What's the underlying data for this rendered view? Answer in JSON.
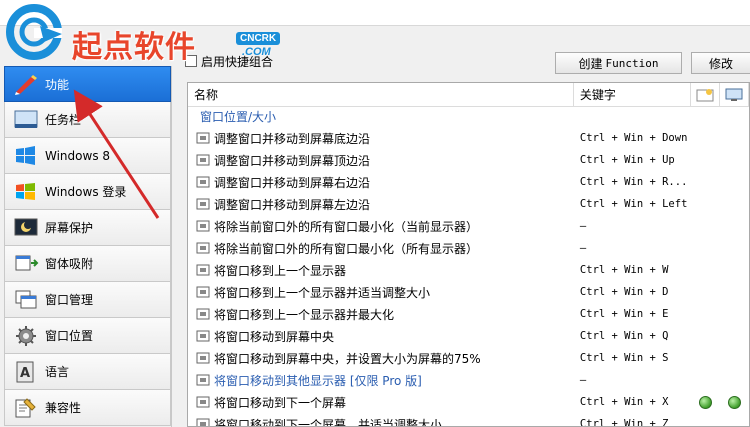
{
  "logo": {
    "text": "起点软件",
    "badge": "CNCRK",
    "domain": ".COM"
  },
  "options": {
    "checkbox_label": "启用快捷组合"
  },
  "toolbar": {
    "create_prefix": "创建",
    "create_keyword": "Function",
    "edit_label": "修改"
  },
  "sidebar": {
    "items": [
      {
        "label": "功能",
        "icon": "pen-icon",
        "active": true
      },
      {
        "label": "任务栏",
        "icon": "taskbar-icon"
      },
      {
        "label": "Windows 8",
        "icon": "windows8-icon"
      },
      {
        "label": "Windows 登录",
        "icon": "windows-logo-icon"
      },
      {
        "label": "屏幕保护",
        "icon": "screensaver-icon"
      },
      {
        "label": "窗体吸附",
        "icon": "window-snap-icon"
      },
      {
        "label": "窗口管理",
        "icon": "window-manage-icon"
      },
      {
        "label": "窗口位置",
        "icon": "gear-icon"
      },
      {
        "label": "语言",
        "icon": "language-icon"
      },
      {
        "label": "兼容性",
        "icon": "compatibility-icon"
      }
    ]
  },
  "table": {
    "headers": {
      "name": "名称",
      "key": "关键字"
    },
    "group": "窗口位置/大小",
    "rows": [
      {
        "name": "调整窗口并移动到屏幕底边沿",
        "key": "Ctrl + Win + Down",
        "dots": 0
      },
      {
        "name": "调整窗口并移动到屏幕顶边沿",
        "key": "Ctrl + Win + Up",
        "dots": 0
      },
      {
        "name": "调整窗口并移动到屏幕右边沿",
        "key": "Ctrl + Win + R...",
        "dots": 0
      },
      {
        "name": "调整窗口并移动到屏幕左边沿",
        "key": "Ctrl + Win + Left",
        "dots": 0
      },
      {
        "name": "将除当前窗口外的所有窗口最小化（当前显示器）",
        "key": "—",
        "dots": 0
      },
      {
        "name": "将除当前窗口外的所有窗口最小化（所有显示器）",
        "key": "—",
        "dots": 0
      },
      {
        "name": "将窗口移到上一个显示器",
        "key": "Ctrl + Win + W",
        "dots": 0
      },
      {
        "name": "将窗口移到上一个显示器并适当调整大小",
        "key": "Ctrl + Win + D",
        "dots": 0
      },
      {
        "name": "将窗口移到上一个显示器并最大化",
        "key": "Ctrl + Win + E",
        "dots": 0
      },
      {
        "name": "将窗口移动到屏幕中央",
        "key": "Ctrl + Win + Q",
        "dots": 0
      },
      {
        "name": "将窗口移动到屏幕中央，并设置大小为屏幕的75%",
        "key": "Ctrl + Win + S",
        "dots": 0
      },
      {
        "name": "将窗口移动到其他显示器 [仅限 Pro 版]",
        "key": "—",
        "dots": 0,
        "pro": true
      },
      {
        "name": "将窗口移动到下一个屏幕",
        "key": "Ctrl + Win + X",
        "dots": 2
      },
      {
        "name": "将窗口移动到下一个屏幕，并适当调整大小",
        "key": "Ctrl + Win + Z",
        "dots": 0
      }
    ]
  },
  "colors": {
    "accent": "#1b6fd6",
    "group_text": "#2a5db0",
    "arrow": "#d42a2a",
    "logo_red": "#e8452b",
    "logo_blue": "#1a8fd9"
  }
}
